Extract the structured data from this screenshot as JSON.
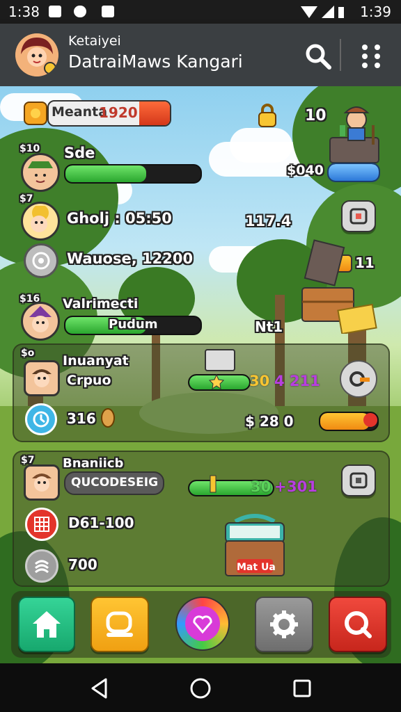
{
  "status_bar": {
    "time_left": "1:38",
    "time_right": "1:39"
  },
  "header": {
    "subtitle": "Ketaiyei",
    "title": "DatraiMaws Kangari"
  },
  "top_row": {
    "label": "Meanta",
    "value": "1920",
    "lock_count": "10"
  },
  "rows": [
    {
      "badge": "$10",
      "name": "Sde",
      "bar_progress": 0.6
    },
    {
      "badge": "$7",
      "text": "Gholj : 05:50"
    },
    {
      "text": "Wauose, 12200"
    },
    {
      "badge": "$16",
      "name": "Valrimecti",
      "bar_label": "Pudum",
      "bar_progress": 0.6
    }
  ],
  "right_column": {
    "coins": "$040",
    "mid_value": "117.4",
    "crate_count": "11",
    "net_value": "Nt1"
  },
  "panel1": {
    "badge": "$o",
    "name": "Inuanyat",
    "tag": "Crpuo",
    "timer_value": "316",
    "progress_left": "30",
    "progress_right": "4 211",
    "cost_value": "$ 28 0"
  },
  "panel2": {
    "badge": "$7",
    "name": "Bnaniicb",
    "code": "QUCODESEIG",
    "grid_value": "D61-100",
    "spin_value": "700",
    "progress_left": "30",
    "progress_right": "301",
    "chest_label": "Mat Ua"
  },
  "colors": {
    "green": "#2aa62e",
    "orange": "#f08a12",
    "blue": "#2c78d8",
    "header_bg": "#3b3f42"
  },
  "nav": {
    "items": [
      "home-icon",
      "chat-icon",
      "heart-icon",
      "gear-icon",
      "search-icon"
    ]
  }
}
